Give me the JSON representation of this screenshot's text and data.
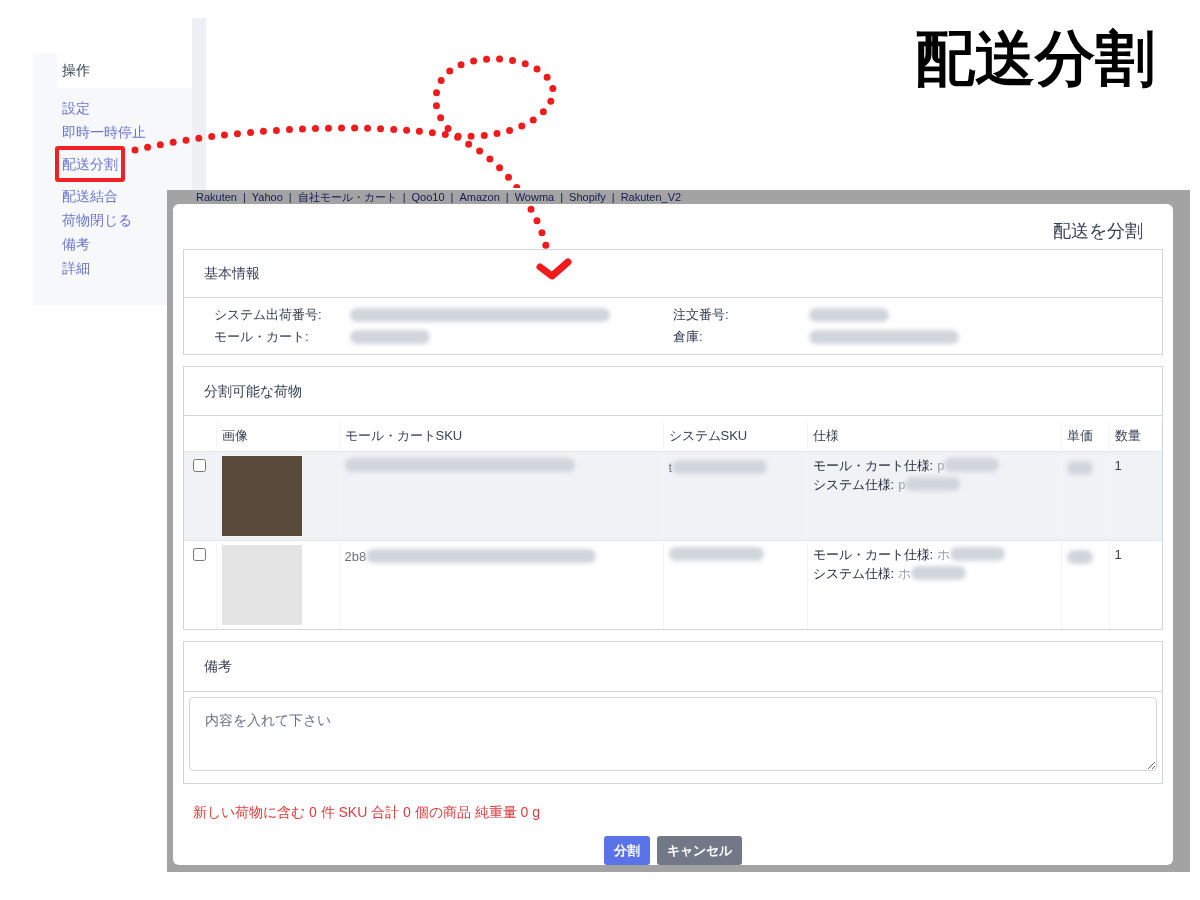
{
  "annotation": {
    "title": "配送分割"
  },
  "menu": {
    "header": "操作",
    "items": [
      {
        "label": "設定",
        "highlighted": false
      },
      {
        "label": "即時一時停止",
        "highlighted": false
      },
      {
        "label": "配送分割",
        "highlighted": true
      },
      {
        "label": "配送結合",
        "highlighted": false
      },
      {
        "label": "荷物閉じる",
        "highlighted": false
      },
      {
        "label": "備考",
        "highlighted": false
      },
      {
        "label": "詳細",
        "highlighted": false
      }
    ]
  },
  "nav_separator": "|",
  "nav_links": [
    "Rakuten",
    "Yahoo",
    "自社モール・カート",
    "Qoo10",
    "Amazon",
    "Wowma",
    "Shopify",
    "Rakuten_V2"
  ],
  "dialog": {
    "title": "配送を分割",
    "basic_info": {
      "title": "基本情報",
      "fields": [
        {
          "label": "システム出荷番号:"
        },
        {
          "label": "モール・カート:"
        },
        {
          "label": "注文番号:"
        },
        {
          "label": "倉庫:"
        }
      ]
    },
    "items_panel": {
      "title": "分割可能な荷物",
      "columns": [
        "画像",
        "モール・カートSKU",
        "システムSKU",
        "仕様",
        "単価",
        "数量"
      ],
      "rows": [
        {
          "checked": false,
          "hovered": true,
          "system_sku": "t",
          "mall_spec_label": "モール・カート仕様:",
          "mall_spec": "p",
          "system_spec_label": "システム仕様:",
          "system_spec": "p",
          "quantity": "1"
        },
        {
          "checked": false,
          "hovered": false,
          "mall_sku": "2b8",
          "mall_spec_label": "モール・カート仕様:",
          "mall_spec": "ホ",
          "system_spec_label": "システム仕様:",
          "system_spec": "ホ",
          "quantity": "1"
        }
      ]
    },
    "remarks": {
      "title": "備考",
      "placeholder": "内容を入れて下さい"
    },
    "summary": "新しい荷物に含む 0 件 SKU 合計 0 個の商品 純重量 0 g",
    "buttons": [
      {
        "label": "分割",
        "kind": "primary"
      },
      {
        "label": "キャンセル",
        "kind": "secondary"
      }
    ]
  }
}
